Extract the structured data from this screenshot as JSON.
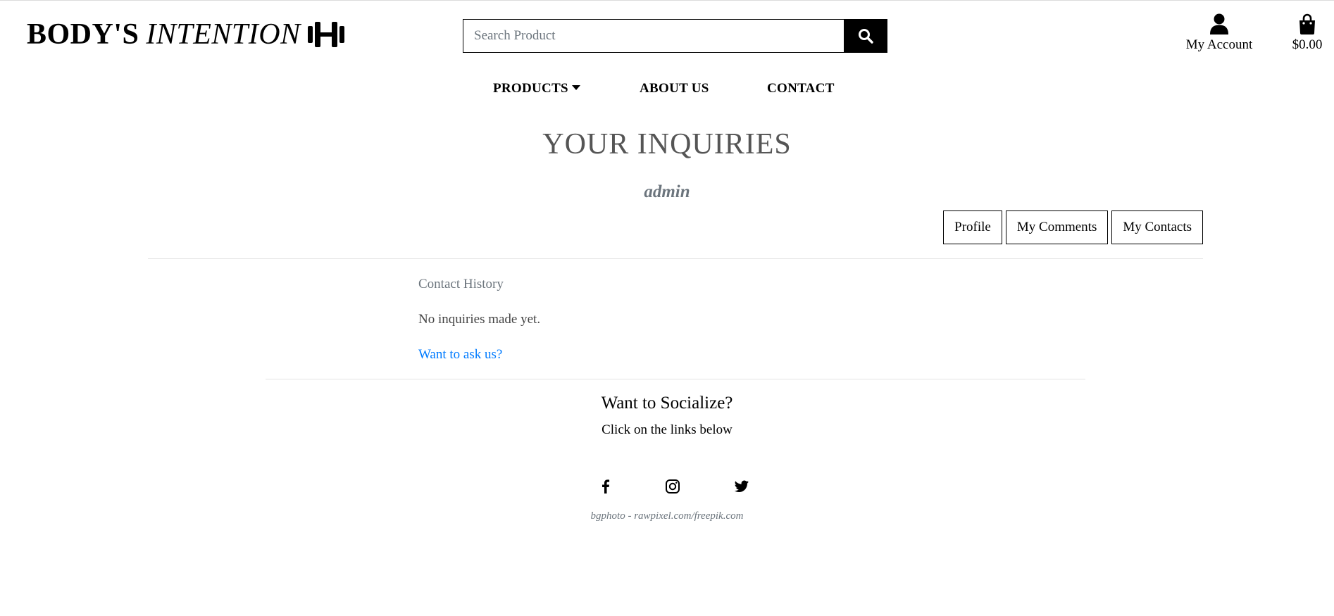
{
  "brand": {
    "name_bold": "BODY'S",
    "name_italic": "INTENTION"
  },
  "search": {
    "placeholder": "Search Product",
    "value": ""
  },
  "header": {
    "account_label": "My Account",
    "cart_total": "$0.00"
  },
  "nav": {
    "products": "PRODUCTS",
    "about": "ABOUT US",
    "contact": "CONTACT"
  },
  "main": {
    "title": "YOUR INQUIRIES",
    "username": "admin",
    "buttons": {
      "profile": "Profile",
      "comments": "My Comments",
      "contacts": "My Contacts"
    },
    "section_heading": "Contact History",
    "empty_message": "No inquiries made yet.",
    "ask_link": "Want to ask us?"
  },
  "footer": {
    "social_title": "Want to Socialize?",
    "social_subtitle": "Click on the links below",
    "icons": [
      "facebook-icon",
      "instagram-icon",
      "twitter-icon"
    ],
    "credit": "bgphoto - rawpixel.com/freepik.com"
  },
  "colors": {
    "link": "#007bff",
    "muted": "#6c757d",
    "title": "#555555",
    "search_button": "#000000"
  }
}
